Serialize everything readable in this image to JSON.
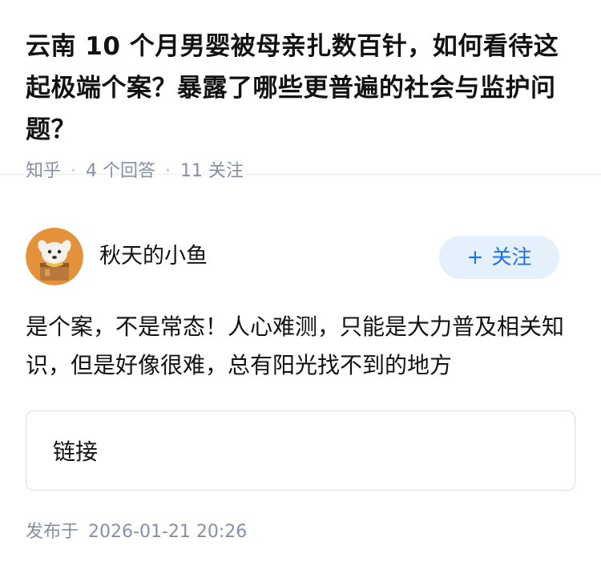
{
  "question": {
    "title": "云南 10 个月男婴被母亲扎数百针，如何看待这起极端个案？暴露了哪些更普遍的社会与监护问题？",
    "source": "知乎",
    "answers_count": "4 个回答",
    "followers_count": "11 关注"
  },
  "answer": {
    "author": {
      "name": "秋天的小鱼",
      "avatar_icon": "dog-avatar-icon"
    },
    "follow_button": {
      "label": "关注",
      "icon": "plus-icon"
    },
    "content": "是个案，不是常态！人心难测，只能是大力普及相关知识，但是好像很难，总有阳光找不到的地方",
    "link_card": {
      "label": "链接"
    },
    "publish": {
      "label": "发布于",
      "datetime": "2026-01-21 20:26"
    }
  },
  "colors": {
    "accent": "#1772f6",
    "follow_bg": "#e5f0fd",
    "meta_text": "#8590a6",
    "avatar_bg": "#e3923a"
  }
}
